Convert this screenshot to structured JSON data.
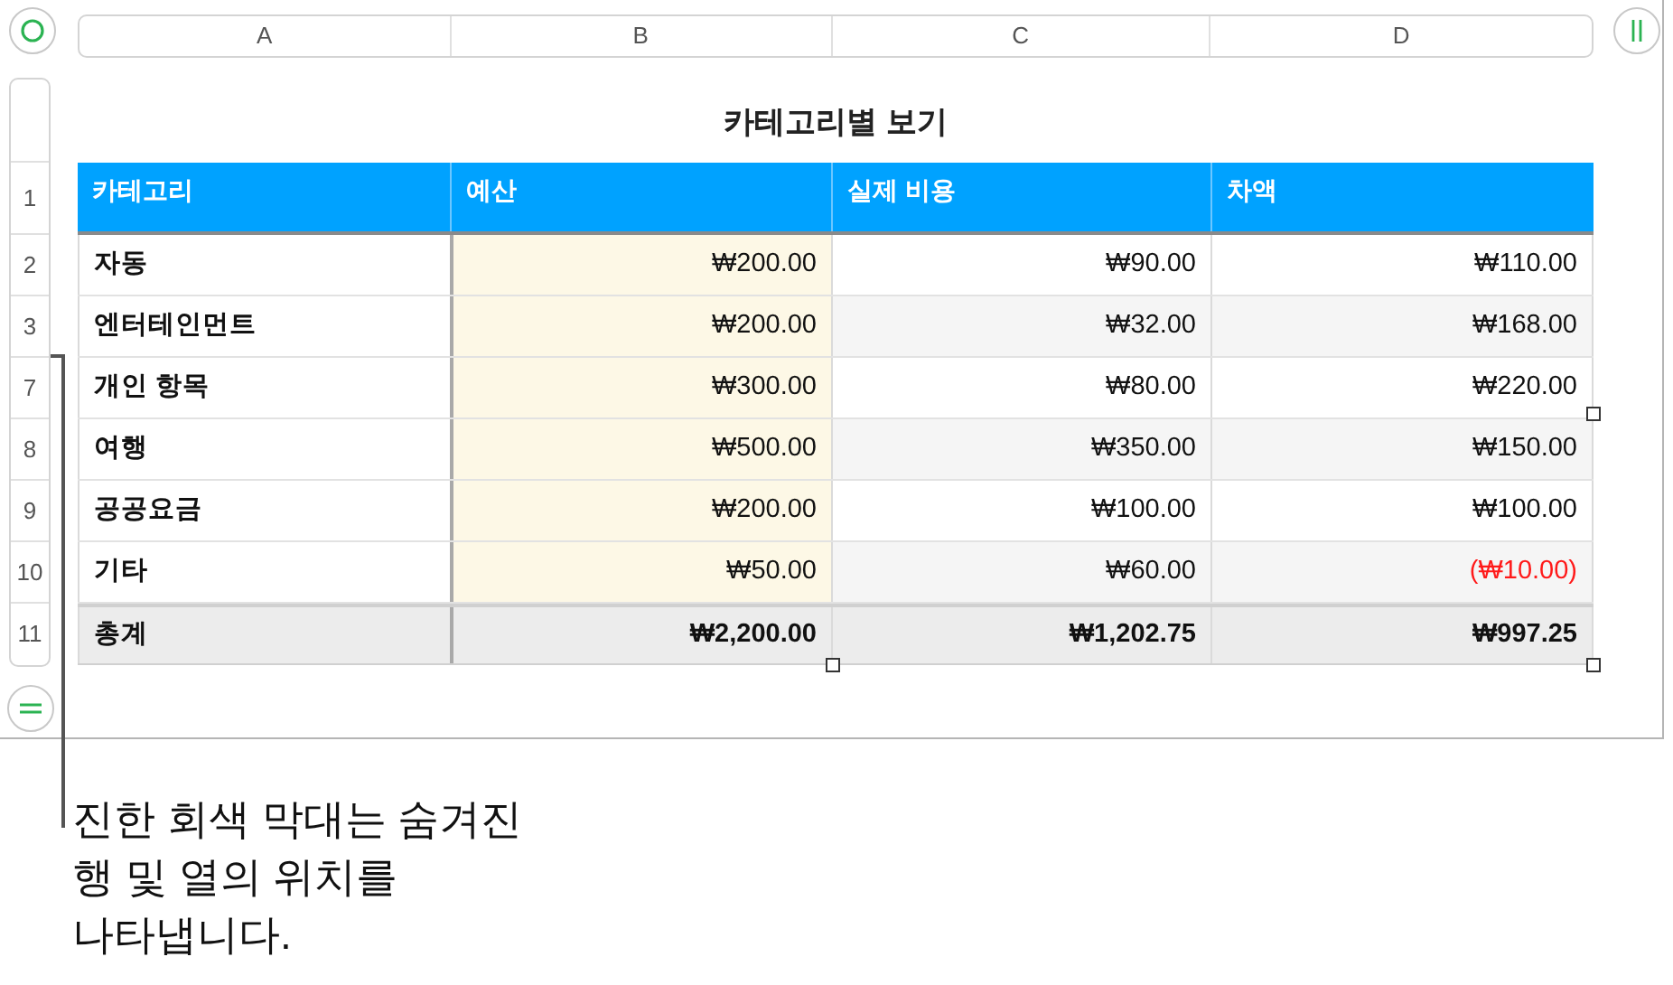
{
  "column_headers": [
    "A",
    "B",
    "C",
    "D"
  ],
  "row_headers": [
    "1",
    "2",
    "3",
    "7",
    "8",
    "9",
    "10",
    "11"
  ],
  "table": {
    "title": "카테고리별 보기",
    "columns": [
      "카테고리",
      "예산",
      "실제 비용",
      "차액"
    ],
    "rows": [
      {
        "kind": "data",
        "cells": [
          "자동",
          "₩200.00",
          "₩90.00",
          "₩110.00"
        ],
        "negative": false
      },
      {
        "kind": "data",
        "cells": [
          "엔터테인먼트",
          "₩200.00",
          "₩32.00",
          "₩168.00"
        ],
        "negative": false
      },
      {
        "kind": "data",
        "cells": [
          "개인 항목",
          "₩300.00",
          "₩80.00",
          "₩220.00"
        ],
        "negative": false
      },
      {
        "kind": "data",
        "cells": [
          "여행",
          "₩500.00",
          "₩350.00",
          "₩150.00"
        ],
        "negative": false
      },
      {
        "kind": "data",
        "cells": [
          "공공요금",
          "₩200.00",
          "₩100.00",
          "₩100.00"
        ],
        "negative": false
      },
      {
        "kind": "data",
        "cells": [
          "기타",
          "₩50.00",
          "₩60.00",
          "(₩10.00)"
        ],
        "negative": true
      },
      {
        "kind": "total",
        "cells": [
          "총계",
          "₩2,200.00",
          "₩1,202.75",
          "₩997.25"
        ],
        "negative": false
      }
    ]
  },
  "caption_lines": [
    "진한 회색 막대는 숨겨진",
    "행 및 열의 위치를",
    "나타냅니다."
  ]
}
